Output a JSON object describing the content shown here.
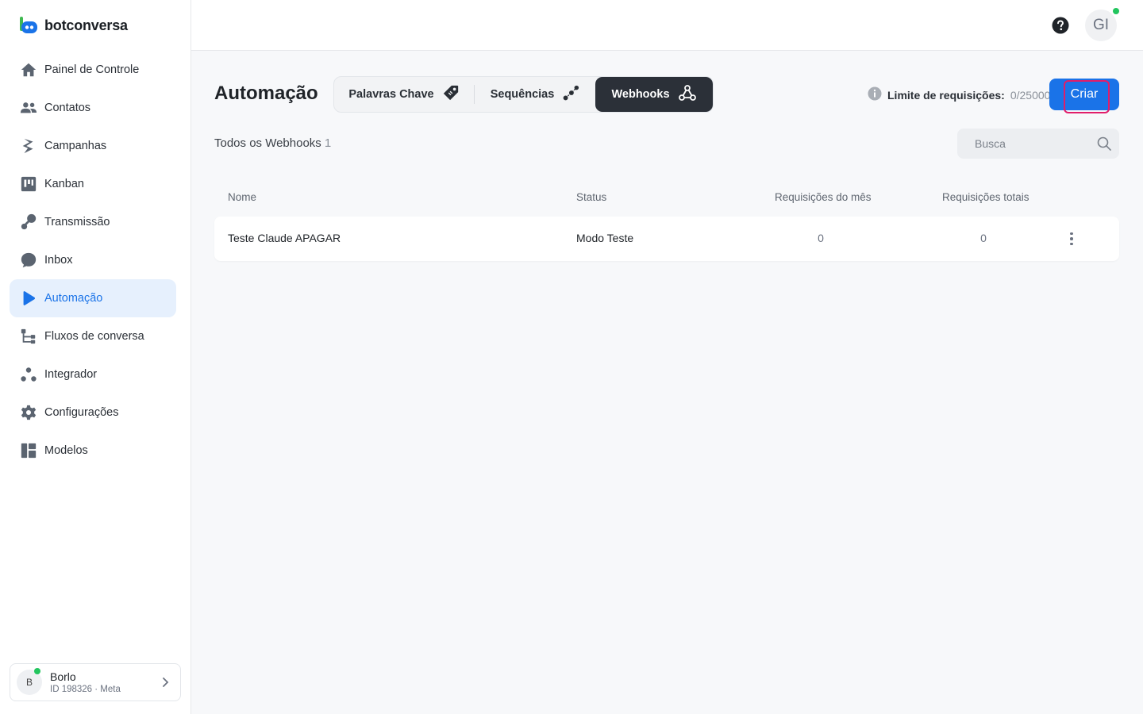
{
  "brand": {
    "name": "botconversa"
  },
  "sidebar": {
    "items": [
      {
        "label": "Painel de Controle",
        "icon": "home-icon"
      },
      {
        "label": "Contatos",
        "icon": "users-icon"
      },
      {
        "label": "Campanhas",
        "icon": "campaign-icon"
      },
      {
        "label": "Kanban",
        "icon": "kanban-icon"
      },
      {
        "label": "Transmissão",
        "icon": "broadcast-icon"
      },
      {
        "label": "Inbox",
        "icon": "chat-bubble-icon"
      },
      {
        "label": "Automação",
        "icon": "play-icon",
        "active": true
      },
      {
        "label": "Fluxos de conversa",
        "icon": "flow-icon"
      },
      {
        "label": "Integrador",
        "icon": "integrator-icon"
      },
      {
        "label": "Configurações",
        "icon": "gear-icon"
      },
      {
        "label": "Modelos",
        "icon": "templates-icon"
      }
    ]
  },
  "account": {
    "initial": "B",
    "name": "Borlo",
    "id_text": "ID 198326 · Meta"
  },
  "topbar": {
    "user_initials": "GI"
  },
  "page": {
    "title": "Automação",
    "tabs": [
      {
        "label": "Palavras Chave",
        "icon": "tag-icon"
      },
      {
        "label": "Sequências",
        "icon": "sequence-icon"
      },
      {
        "label": "Webhooks",
        "icon": "webhook-icon",
        "active": true
      }
    ],
    "limit": {
      "label": "Limite de requisições:",
      "value": "0/25000"
    },
    "create_button": "Criar",
    "section_title": "Todos os Webhooks",
    "section_count": "1",
    "search_placeholder": "Busca"
  },
  "table": {
    "columns": [
      "Nome",
      "Status",
      "Requisições do mês",
      "Requisições totais"
    ],
    "rows": [
      {
        "name": "Teste Claude APAGAR",
        "status": "Modo Teste",
        "month": "0",
        "total": "0"
      }
    ]
  },
  "colors": {
    "accent": "#1a73e8",
    "active_bg": "#e6f0fd",
    "online": "#22c55e",
    "highlight": "#e11d6a"
  }
}
